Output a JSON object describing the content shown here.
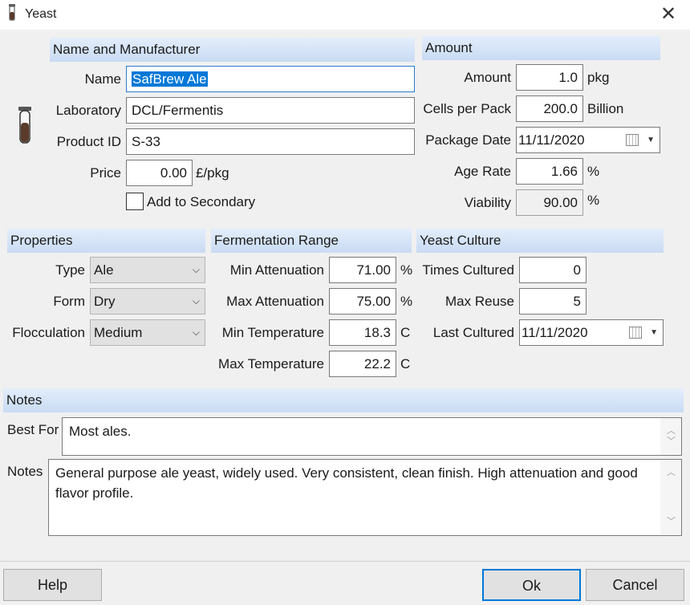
{
  "window": {
    "title": "Yeast",
    "close_glyph": "✕"
  },
  "icons": {
    "app": "test-tube-icon",
    "calendar": "calendar-icon",
    "close": "close-icon"
  },
  "name_section": {
    "header": "Name and Manufacturer",
    "name_label": "Name",
    "name_value": "SafBrew Ale",
    "lab_label": "Laboratory",
    "lab_value": "DCL/Fermentis",
    "pid_label": "Product ID",
    "pid_value": "S-33",
    "price_label": "Price",
    "price_value": "0.00",
    "price_unit": "£/pkg",
    "secondary_label": "Add to Secondary",
    "secondary_checked": false
  },
  "amount_section": {
    "header": "Amount",
    "amount_label": "Amount",
    "amount_value": "1.0",
    "amount_unit": "pkg",
    "cells_label": "Cells per Pack",
    "cells_value": "200.0",
    "cells_unit": "Billion",
    "pkgdate_label": "Package Date",
    "pkgdate_value": "11/11/2020",
    "age_label": "Age Rate",
    "age_value": "1.66",
    "age_unit": "%",
    "viability_label": "Viability",
    "viability_value": "90.00",
    "viability_unit": "%"
  },
  "properties": {
    "header": "Properties",
    "type_label": "Type",
    "type_value": "Ale",
    "form_label": "Form",
    "form_value": "Dry",
    "floc_label": "Flocculation",
    "floc_value": "Medium"
  },
  "fermentation": {
    "header": "Fermentation Range",
    "minatt_label": "Min Attenuation",
    "minatt_value": "71.00",
    "minatt_unit": "%",
    "maxatt_label": "Max Attenuation",
    "maxatt_value": "75.00",
    "maxatt_unit": "%",
    "mintemp_label": "Min Temperature",
    "mintemp_value": "18.3",
    "mintemp_unit": "C",
    "maxtemp_label": "Max Temperature",
    "maxtemp_value": "22.2",
    "maxtemp_unit": "C"
  },
  "culture": {
    "header": "Yeast Culture",
    "times_label": "Times Cultured",
    "times_value": "0",
    "reuse_label": "Max Reuse",
    "reuse_value": "5",
    "last_label": "Last Cultured",
    "last_value": "11/11/2020"
  },
  "notes": {
    "header": "Notes",
    "bestfor_label": "Best For",
    "bestfor_value": "Most ales.",
    "notes_label": "Notes",
    "notes_value": "General purpose ale yeast, widely used.  Very consistent, clean finish. High attenuation and good flavor profile."
  },
  "buttons": {
    "help": "Help",
    "ok": "Ok",
    "cancel": "Cancel"
  },
  "glyphs": {
    "combo_arrow": "⌵",
    "date_arrow": "▼",
    "scroll_up": "︿",
    "scroll_down": "﹀"
  }
}
